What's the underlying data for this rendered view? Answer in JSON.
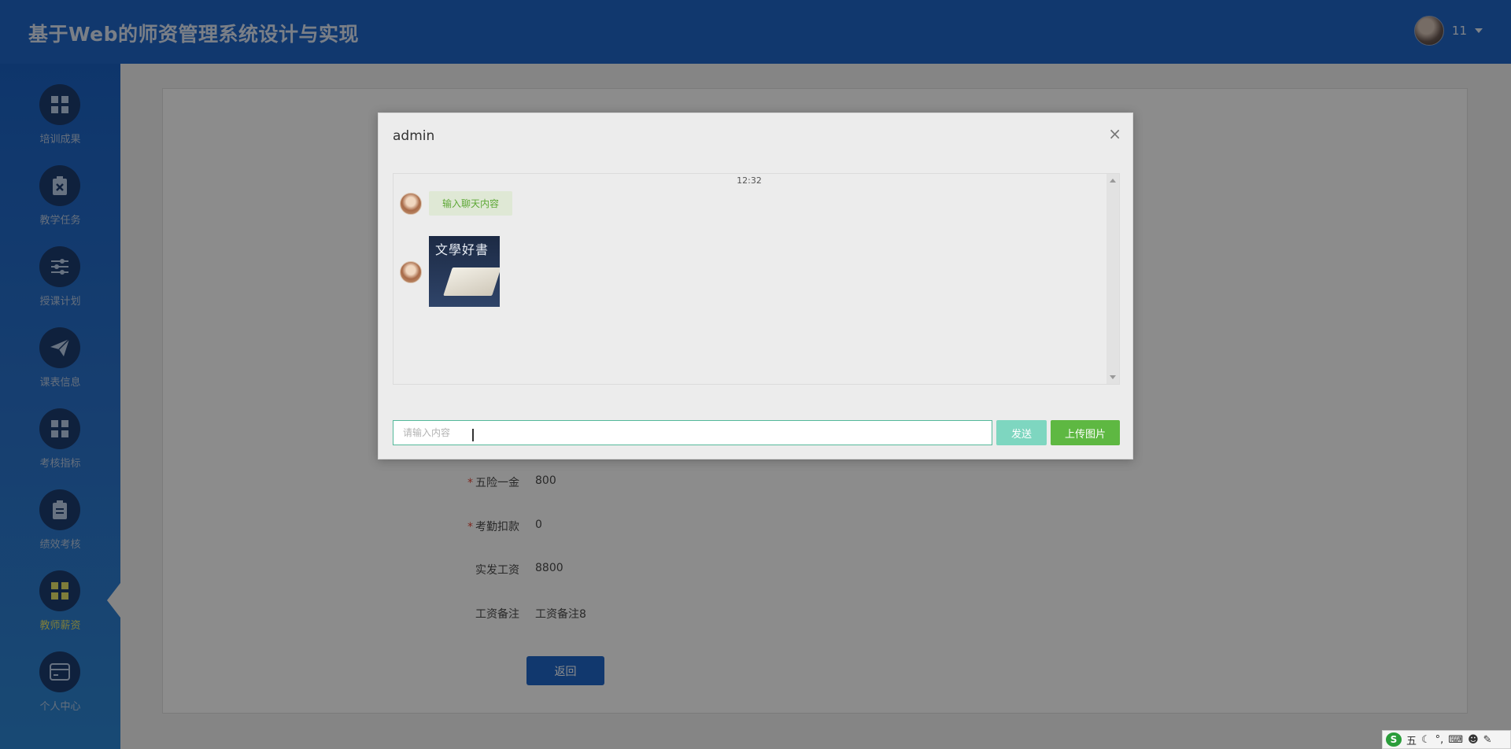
{
  "header": {
    "title": "基于Web的师资管理系统设计与实现",
    "username": "11"
  },
  "sidebar": {
    "items": [
      {
        "label": "培训成果",
        "icon": "grid-icon"
      },
      {
        "label": "教学任务",
        "icon": "clipboard-x-icon"
      },
      {
        "label": "授课计划",
        "icon": "sliders-icon"
      },
      {
        "label": "课表信息",
        "icon": "paper-plane-icon"
      },
      {
        "label": "考核指标",
        "icon": "grid-icon"
      },
      {
        "label": "绩效考核",
        "icon": "clipboard-icon"
      },
      {
        "label": "教师薪资",
        "icon": "grid-icon",
        "active": true
      },
      {
        "label": "个人中心",
        "icon": "card-icon"
      }
    ],
    "active_color": "#e6e36a"
  },
  "form": {
    "rows": [
      {
        "label": "五险一金",
        "required": true,
        "value": "800"
      },
      {
        "label": "考勤扣款",
        "required": true,
        "value": "0"
      },
      {
        "label": "实发工资",
        "required": false,
        "value": "8800"
      },
      {
        "label": "工资备注",
        "required": false,
        "value": "工资备注8"
      }
    ],
    "back_label": "返回"
  },
  "dialog": {
    "title": "admin",
    "close_glyph": "×",
    "time": "12:32",
    "messages": [
      {
        "type": "text",
        "text": "输入聊天内容"
      },
      {
        "type": "image",
        "caption": "文學好書"
      }
    ],
    "input_placeholder": "请输入内容",
    "send_label": "发送",
    "upload_label": "上传图片"
  },
  "ime": {
    "mode": "五"
  }
}
